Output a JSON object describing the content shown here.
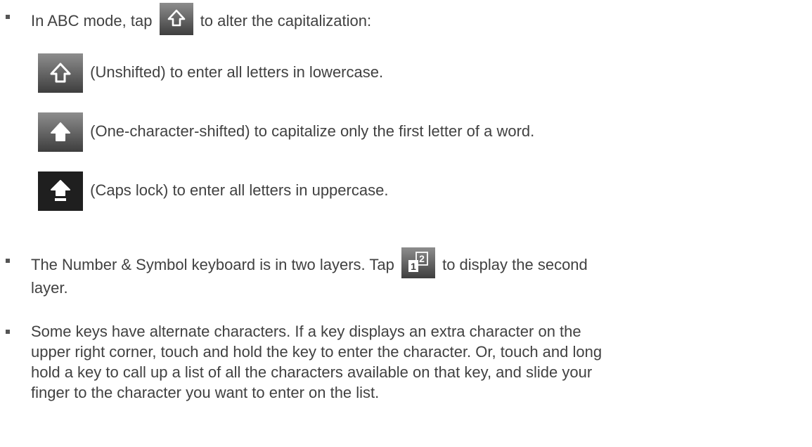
{
  "bullets": [
    {
      "before": "In ABC mode, tap",
      "after": "to alter the capitalization:",
      "key_icon": "shift-unshifted-icon"
    },
    {
      "before": "The Number & Symbol keyboard is in two layers. Tap",
      "after": "to display the second",
      "key_icon": "layer-switch-icon",
      "continuation": "layer."
    },
    {
      "lines": [
        "Some keys have alternate characters. If a key displays an extra character on the",
        "upper right corner, touch and hold the key to enter the character. Or, touch and long",
        "hold a key to call up a list of all the characters available on that key, and slide your",
        "finger to the character you want to enter on the list."
      ]
    }
  ],
  "shift_states": [
    {
      "icon": "shift-unshifted-icon",
      "text": "(Unshifted) to enter all letters in lowercase."
    },
    {
      "icon": "shift-one-character-icon",
      "text": "(One-character-shifted) to capitalize only the first letter of a word."
    },
    {
      "icon": "caps-lock-icon",
      "text": "(Caps lock) to enter all letters in uppercase."
    }
  ],
  "icons": {
    "layer_key_small": "1",
    "layer_key_large": "2"
  },
  "colors": {
    "text": "#414141",
    "key_dark": "#3a3a3a",
    "key_light": "#8a8a8a",
    "caps_lock": "#1f1f1f"
  }
}
